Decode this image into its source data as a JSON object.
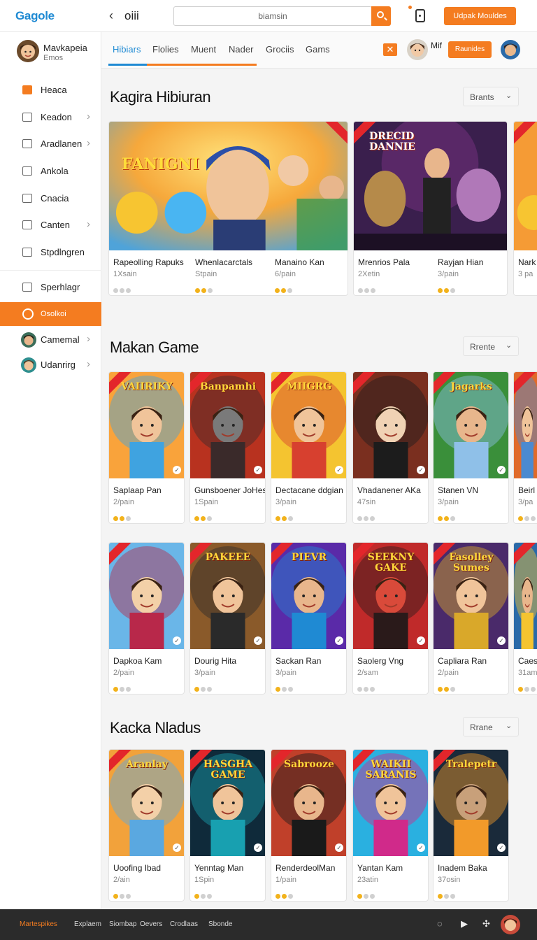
{
  "topbar": {
    "logo": "Gagole",
    "title": "oiii",
    "search_value": "biamsin",
    "cta_label": "Udpak Mouldes"
  },
  "sidebar": {
    "profile": {
      "name": "Mavkapeia",
      "sub": "Emos"
    },
    "items": [
      {
        "label": "Heaca",
        "icon": "game-icon",
        "chevron": false
      },
      {
        "label": "Keadon",
        "icon": "home-icon",
        "chevron": true
      },
      {
        "label": "Aradlanen",
        "icon": "folder-icon",
        "chevron": true
      },
      {
        "label": "Ankola",
        "icon": "image-icon",
        "chevron": false
      },
      {
        "label": "Cnacia",
        "icon": "chart-icon",
        "chevron": false
      },
      {
        "label": "Canten",
        "icon": "edit-icon",
        "chevron": true
      },
      {
        "label": "Stpdlngren",
        "icon": "stats-icon",
        "chevron": false
      },
      {
        "label": "Sperhlagr",
        "icon": "book-icon",
        "chevron": false
      },
      {
        "label": "Osolkoi",
        "icon": "globe-icon",
        "chevron": false,
        "active": true
      },
      {
        "label": "Camemal",
        "icon": "avatar",
        "chevron": true
      },
      {
        "label": "Udanrirg",
        "icon": "avatar",
        "chevron": true
      }
    ]
  },
  "tabs": {
    "items": [
      "Hibiars",
      "Flolies",
      "Muent",
      "Nader",
      "Grociis",
      "Gams"
    ],
    "user_label": "Mif",
    "button_label": "Raunides"
  },
  "sections": [
    {
      "title": "Kagira Hibiuran",
      "sort_label": "Brants"
    },
    {
      "title": "Makan Game",
      "sort_label": "Rrente"
    },
    {
      "title": "Kacka Nladus",
      "sort_label": "Rrane"
    }
  ],
  "featured": [
    {
      "name": "Rapeolling Rapuks",
      "meta": "1Xsain",
      "rating": 0
    },
    {
      "name": "Whenlacarctals",
      "meta": "Stpain",
      "rating": 2
    },
    {
      "name": "Manaino Kan",
      "meta": "6/pain",
      "rating": 2
    },
    {
      "name": "Mrenrios Pala",
      "meta": "2Xetin",
      "rating": 0
    },
    {
      "name": "Rayjan Hian",
      "meta": "3/pain",
      "rating": 2
    },
    {
      "name": "Nark",
      "meta": "3 pa",
      "rating": 0
    }
  ],
  "featured_thumbs": [
    "FANIGNI",
    "",
    "",
    "DRECID DANNIE",
    "",
    ""
  ],
  "row2": [
    {
      "name": "Saplaap Pan",
      "meta": "2/pain",
      "rating": 2,
      "art": "VAIIRIKY"
    },
    {
      "name": "Gunsboener JoHesa",
      "meta": "1Spain",
      "rating": 2,
      "art": "Banpamhi"
    },
    {
      "name": "Dectacane ddgian",
      "meta": "3/pain",
      "rating": 2,
      "art": "MIIGRG"
    },
    {
      "name": "Vhadanener AKa",
      "meta": "47sin",
      "rating": 0,
      "art": ""
    },
    {
      "name": "Stanen VN",
      "meta": "3/pain",
      "rating": 2,
      "art": "Jagarks"
    },
    {
      "name": "Beirl",
      "meta": "3/pa",
      "rating": 1,
      "art": ""
    }
  ],
  "row3": [
    {
      "name": "Dapkoa Kam",
      "meta": "2/pain",
      "rating": 1,
      "art": ""
    },
    {
      "name": "Dourig Hita",
      "meta": "3/pain",
      "rating": 1,
      "art": "PAKEEE"
    },
    {
      "name": "Sackan Ran",
      "meta": "3/pain",
      "rating": 1,
      "art": "PIEVR"
    },
    {
      "name": "Saolerg Vng",
      "meta": "2/sam",
      "rating": 0,
      "art": "SEEKNY GAKE"
    },
    {
      "name": "Capliara Ran",
      "meta": "2/pain",
      "rating": 2,
      "art": "Fasolley Sumes"
    },
    {
      "name": "Caesl",
      "meta": "31am",
      "rating": 1,
      "art": ""
    }
  ],
  "row4": [
    {
      "name": "Uoofing Ibad",
      "meta": "2/ain",
      "rating": 1,
      "art": "Aranlay"
    },
    {
      "name": "Yenntag Man",
      "meta": "1Spin",
      "rating": 1,
      "art": "HASGHA GAME"
    },
    {
      "name": "RenderdeolMan",
      "meta": "1/pain",
      "rating": 2,
      "art": "Sabrooze"
    },
    {
      "name": "Yantan Kam",
      "meta": "23atin",
      "rating": 1,
      "art": "WAIKII SARANIS"
    },
    {
      "name": "Inadem Baka",
      "meta": "37osin",
      "rating": 1,
      "art": "Tralepetr"
    }
  ],
  "bottombar": {
    "brand": "Martespikes",
    "links": [
      "Explaem",
      "Siombap",
      "Oevers",
      "Crodlaas",
      "Sbonde"
    ]
  },
  "colors": {
    "accent": "#f47c20",
    "brand_blue": "#1f8ad3",
    "ribbon": "#e3262b",
    "star": "#f2b21b"
  }
}
